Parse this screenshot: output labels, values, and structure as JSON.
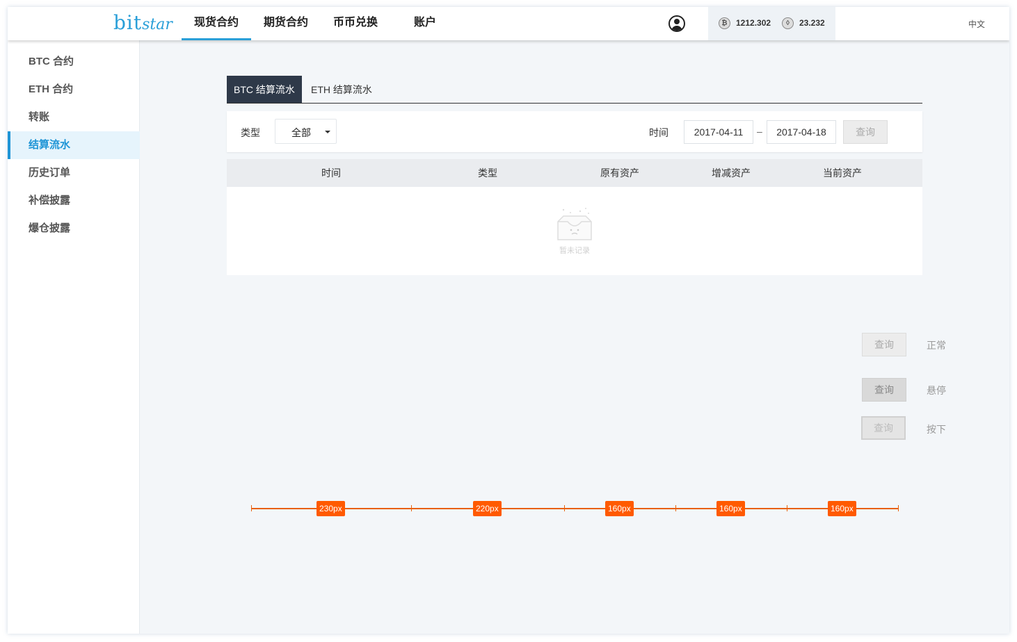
{
  "brand": {
    "logo_main": "bit",
    "logo_sub": "star",
    "color": "#2a9fd8"
  },
  "nav": {
    "items": [
      {
        "label": "现货合约",
        "active": true
      },
      {
        "label": "期货合约",
        "active": false
      },
      {
        "label": "币币兑换",
        "active": false
      },
      {
        "label": "账户",
        "active": false
      }
    ]
  },
  "account": {
    "avatar_icon": "user-avatar-icon",
    "btc_icon": "bitcoin-icon",
    "btc_balance": "1212.302",
    "eth_icon": "ethereum-icon",
    "eth_balance": "23.232",
    "language": "中文"
  },
  "sidebar": {
    "items": [
      {
        "label": "BTC 合约",
        "active": false
      },
      {
        "label": "ETH 合约",
        "active": false
      },
      {
        "label": "转账",
        "active": false
      },
      {
        "label": "结算流水",
        "active": true
      },
      {
        "label": "历史订单",
        "active": false
      },
      {
        "label": "补偿披露",
        "active": false
      },
      {
        "label": "爆仓披露",
        "active": false
      }
    ],
    "accent_color": "#1f95d6"
  },
  "tabs": [
    {
      "label": "BTC 结算流水",
      "active": true
    },
    {
      "label": "ETH 结算流水",
      "active": false
    }
  ],
  "filter": {
    "type_label": "类型",
    "type_value": "全部",
    "time_label": "时间",
    "date_from": "2017-04-11",
    "date_separator": "–",
    "date_to": "2017-04-18",
    "query_label": "查询"
  },
  "table": {
    "columns": [
      "时间",
      "类型",
      "原有资产",
      "增减资产",
      "当前资产"
    ],
    "empty_text": "暂未记录",
    "empty_icon": "empty-inbox-icon"
  },
  "button_states": [
    {
      "button_label": "查询",
      "state_label": "正常"
    },
    {
      "button_label": "查询",
      "state_label": "悬停"
    },
    {
      "button_label": "查询",
      "state_label": "按下"
    }
  ],
  "column_widths": [
    "230px",
    "220px",
    "160px",
    "160px",
    "160px"
  ],
  "annotation_color": "#ff5a00"
}
